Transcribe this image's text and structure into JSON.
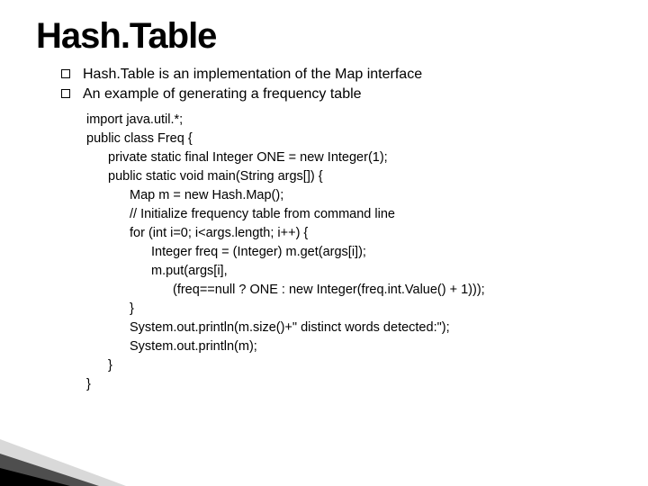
{
  "title": "Hash.Table",
  "bullets": [
    "Hash.Table is an implementation of the Map interface",
    "An example of generating a frequency table"
  ],
  "code": {
    "l0": "import java.util.*;",
    "l1": "public class Freq {",
    "l2": "private static final Integer ONE = new Integer(1);",
    "l3": "public static void main(String args[]) {",
    "l4": "Map m = new Hash.Map();",
    "l5": "// Initialize frequency table from command line",
    "l6": "for (int i=0; i<args.length; i++) {",
    "l7": "Integer freq = (Integer) m.get(args[i]);",
    "l8": "m.put(args[i],",
    "l9": "(freq==null ? ONE : new Integer(freq.int.Value() + 1)));",
    "l10": "}",
    "l11": "System.out.println(m.size()+\" distinct words detected:\");",
    "l12": "System.out.println(m);",
    "l13": "}",
    "l14": "}"
  }
}
